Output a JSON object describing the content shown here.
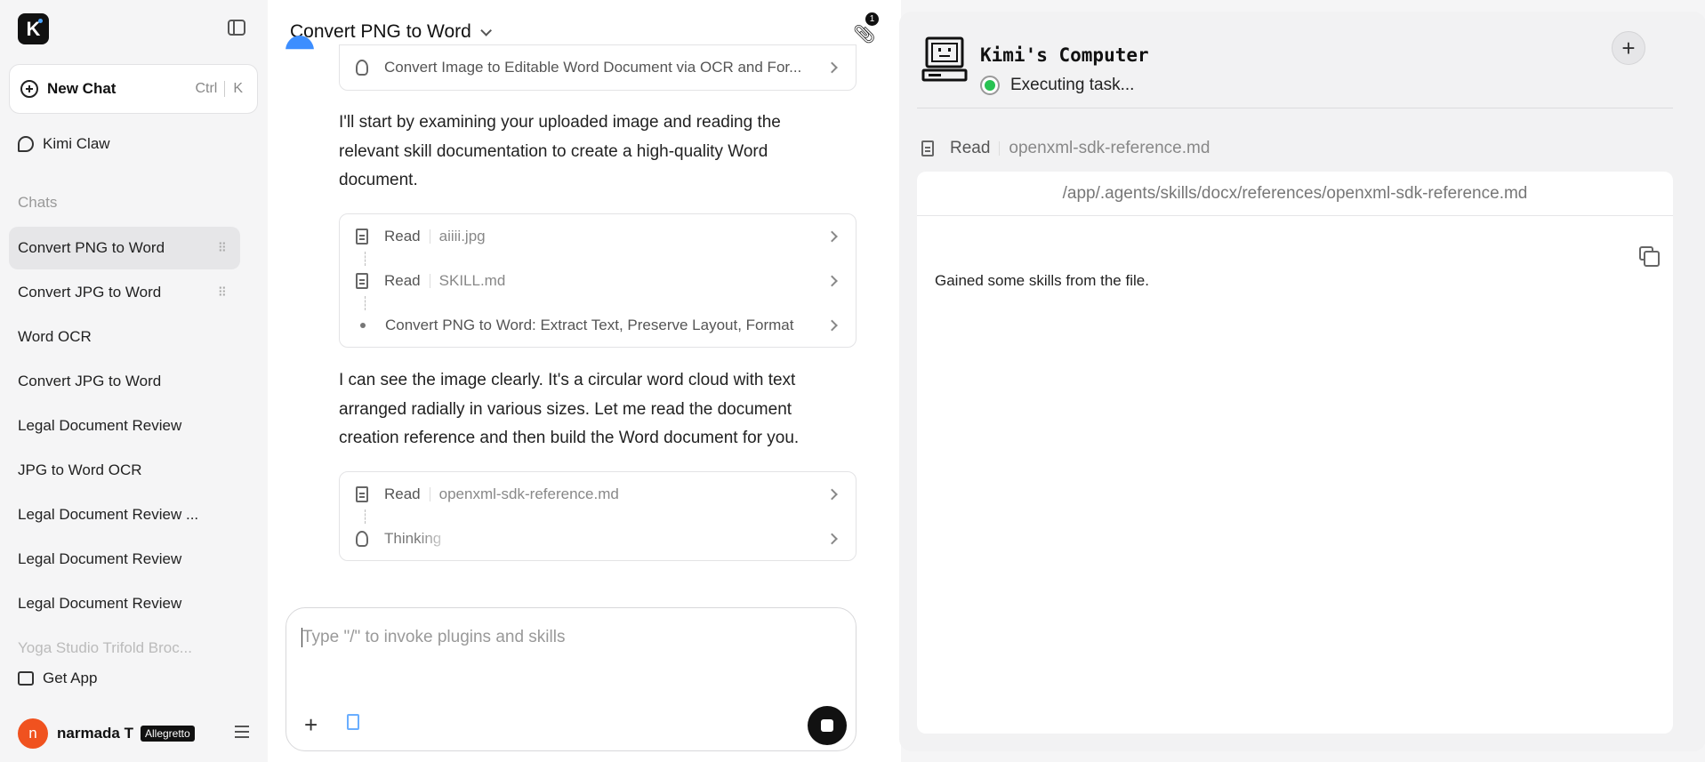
{
  "sidebar": {
    "new_chat_label": "New Chat",
    "shortcut_ctrl": "Ctrl",
    "shortcut_key": "K",
    "kimi_claw_label": "Kimi Claw",
    "chats_section_title": "Chats",
    "chats": [
      {
        "label": "Convert PNG to Word"
      },
      {
        "label": "Convert JPG to Word"
      },
      {
        "label": "Word OCR"
      },
      {
        "label": "Convert JPG to Word"
      },
      {
        "label": "Legal Document Review"
      },
      {
        "label": "JPG to Word OCR"
      },
      {
        "label": "Legal Document Review ..."
      },
      {
        "label": "Legal Document Review"
      },
      {
        "label": "Legal Document Review"
      },
      {
        "label": "Yoga Studio Trifold Broc..."
      }
    ],
    "get_app_label": "Get App",
    "user": {
      "initial": "n",
      "name": "narmada T",
      "plan_badge": "Allegretto"
    }
  },
  "main": {
    "title": "Convert PNG to Word",
    "attachment_count": "1",
    "step_card_top": {
      "label": "Convert Image to Editable Word Document via OCR and For..."
    },
    "paragraph_1": "I'll start by examining your uploaded image and reading the relevant skill documentation to create a high-quality Word document.",
    "step_card_1": [
      {
        "action": "Read",
        "target": "aiiii.jpg"
      },
      {
        "action": "Read",
        "target": "SKILL.md"
      },
      {
        "action": "Convert PNG to Word: Extract Text, Preserve Layout, Format",
        "target": ""
      }
    ],
    "paragraph_2": "I can see the image clearly. It's a circular word cloud with text arranged radially in various sizes. Let me read the document creation reference and then build the Word document for you.",
    "step_card_2": [
      {
        "action": "Read",
        "target": "openxml-sdk-reference.md"
      },
      {
        "action": "Thinking",
        "target": ""
      }
    ],
    "input": {
      "placeholder": "Type \"/\" to invoke plugins and skills"
    }
  },
  "computer": {
    "title": "Kimi's Computer",
    "status": "Executing task...",
    "status_color": "#28c252",
    "current_action": "Read",
    "current_file": "openxml-sdk-reference.md",
    "file_path": "/app/.agents/skills/docx/references/openxml-sdk-reference.md",
    "file_content": "Gained some skills from the file."
  }
}
